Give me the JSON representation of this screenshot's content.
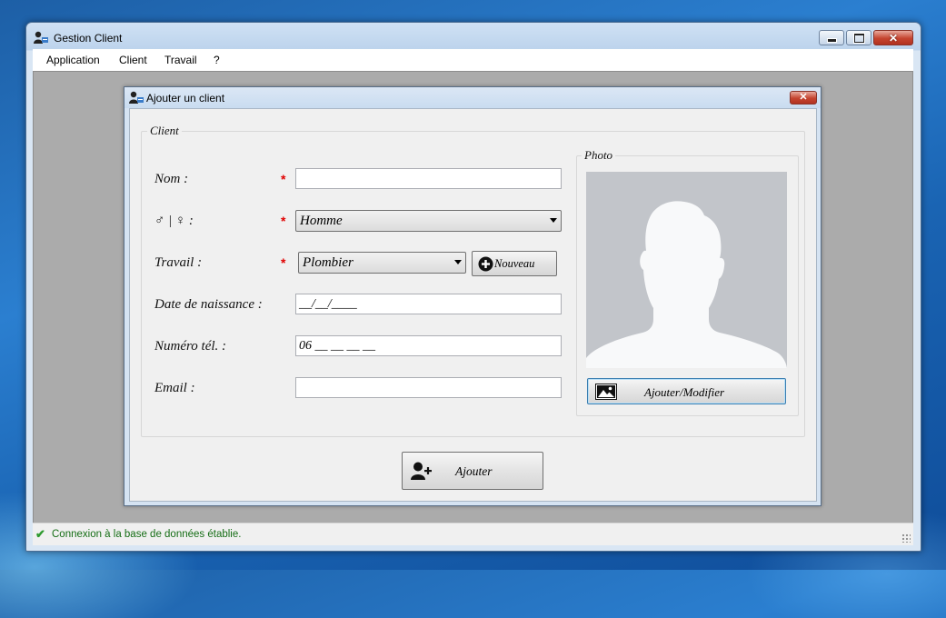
{
  "window": {
    "title": "Gestion Client"
  },
  "menu": {
    "items": [
      "Application",
      "Client",
      "Travail",
      "?"
    ]
  },
  "dialog": {
    "title": "Ajouter un client",
    "client_group": "Client",
    "photo_group": "Photo",
    "fields": {
      "nom_label": "Nom :",
      "sexe_label": "♂ | ♀ :",
      "travail_label": "Travail :",
      "date_label": "Date de naissance :",
      "tel_label": "Numéro tél. :",
      "email_label": "Email :",
      "required_marker": "*",
      "nom_value": "",
      "sexe_value": "Homme",
      "travail_value": "Plombier",
      "date_value": "__/__/____",
      "tel_value": "06 __ __ __ __",
      "email_value": ""
    },
    "buttons": {
      "nouveau": "Nouveau",
      "photo": "Ajouter/Modifier",
      "ajouter": "Ajouter"
    }
  },
  "status": {
    "text": "Connexion à la base de données établie."
  },
  "colors": {
    "required": "#e00000",
    "status_text": "#156d15",
    "mdi_background": "#ababab"
  }
}
